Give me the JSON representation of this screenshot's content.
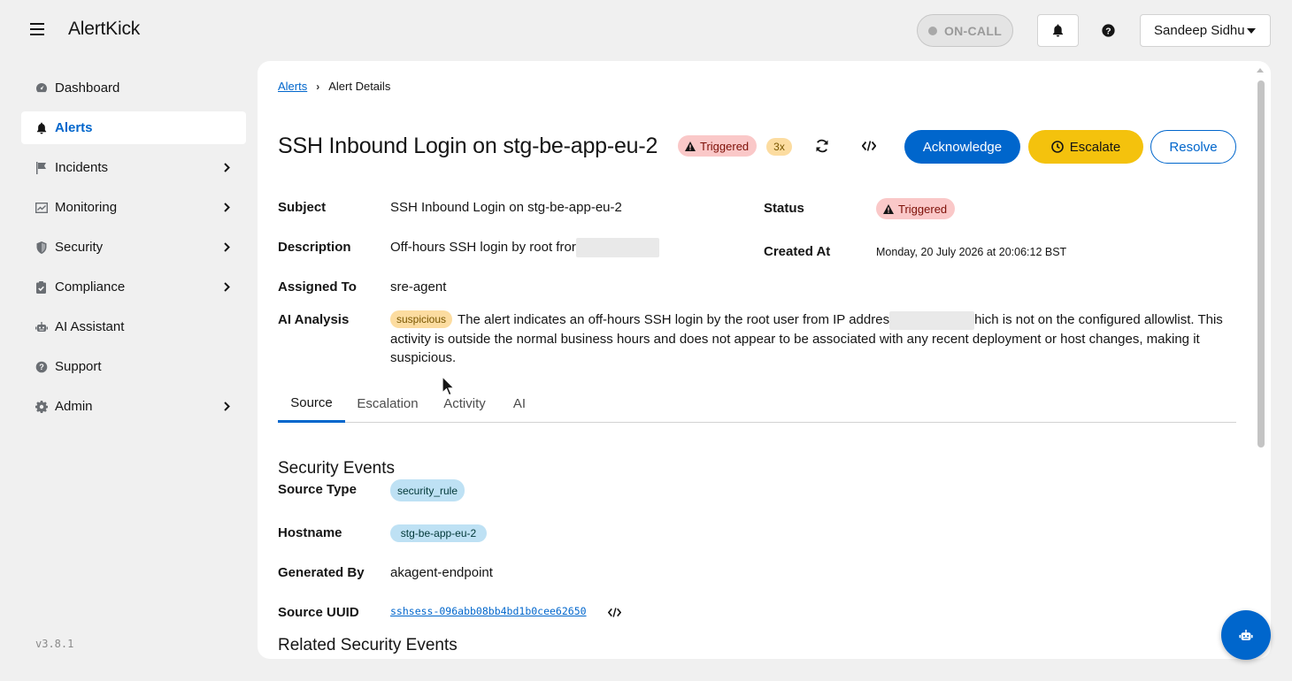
{
  "app": {
    "brand": "AlertKick",
    "version": "v3.8.1"
  },
  "header": {
    "oncall_label": "ON-CALL",
    "user_name": "Sandeep Sidhu"
  },
  "sidebar": {
    "items": [
      {
        "label": "Dashboard",
        "icon": "dashboard-icon",
        "has_children": false,
        "active": false
      },
      {
        "label": "Alerts",
        "icon": "bell-icon",
        "has_children": false,
        "active": true
      },
      {
        "label": "Incidents",
        "icon": "flag-icon",
        "has_children": true,
        "active": false
      },
      {
        "label": "Monitoring",
        "icon": "chart-icon",
        "has_children": true,
        "active": false
      },
      {
        "label": "Security",
        "icon": "shield-icon",
        "has_children": true,
        "active": false
      },
      {
        "label": "Compliance",
        "icon": "clipboard-check-icon",
        "has_children": true,
        "active": false
      },
      {
        "label": "AI Assistant",
        "icon": "robot-icon",
        "has_children": false,
        "active": false
      },
      {
        "label": "Support",
        "icon": "question-circle-icon",
        "has_children": false,
        "active": false
      },
      {
        "label": "Admin",
        "icon": "gear-icon",
        "has_children": true,
        "active": false
      }
    ]
  },
  "breadcrumb": {
    "parent": "Alerts",
    "current": "Alert Details"
  },
  "alert": {
    "title": "SSH Inbound Login on stg-be-app-eu-2",
    "status_badge": "Triggered",
    "count_badge": "3x",
    "actions": {
      "acknowledge": "Acknowledge",
      "escalate": "Escalate",
      "resolve": "Resolve"
    },
    "fields": {
      "subject_label": "Subject",
      "subject": "SSH Inbound Login on stg-be-app-eu-2",
      "description_label": "Description",
      "description": "Off-hours SSH login by root fror",
      "assigned_label": "Assigned To",
      "assigned": "sre-agent",
      "status_label": "Status",
      "status": "Triggered",
      "created_label": "Created At",
      "created": "Monday, 20 July 2026 at 20:06:12 BST",
      "ai_label": "AI Analysis",
      "ai_tag": "suspicious",
      "ai_text_a": "The alert indicates an off-hours SSH login by the root user from IP addres",
      "ai_text_b": "hich is not on the configured allowlist. This activity is outside the normal business hours and does not appear to be associated with any recent deployment or host changes, making it suspicious."
    }
  },
  "tabs": [
    {
      "label": "Source",
      "active": true
    },
    {
      "label": "Escalation",
      "active": false
    },
    {
      "label": "Activity",
      "active": false
    },
    {
      "label": "AI",
      "active": false
    }
  ],
  "source": {
    "heading": "Security Events",
    "source_type_label": "Source Type",
    "source_type": "security_rule",
    "hostname_label": "Hostname",
    "hostname": "stg-be-app-eu-2",
    "generated_by_label": "Generated By",
    "generated_by": "akagent-endpoint",
    "uuid_label": "Source UUID",
    "uuid": "sshsess-096abb08bb4bd1b0cee62650",
    "related_heading": "Related Security Events"
  },
  "colors": {
    "primary": "#0066cc",
    "warning": "#f4c20d",
    "danger_bg": "#fac8c8"
  }
}
